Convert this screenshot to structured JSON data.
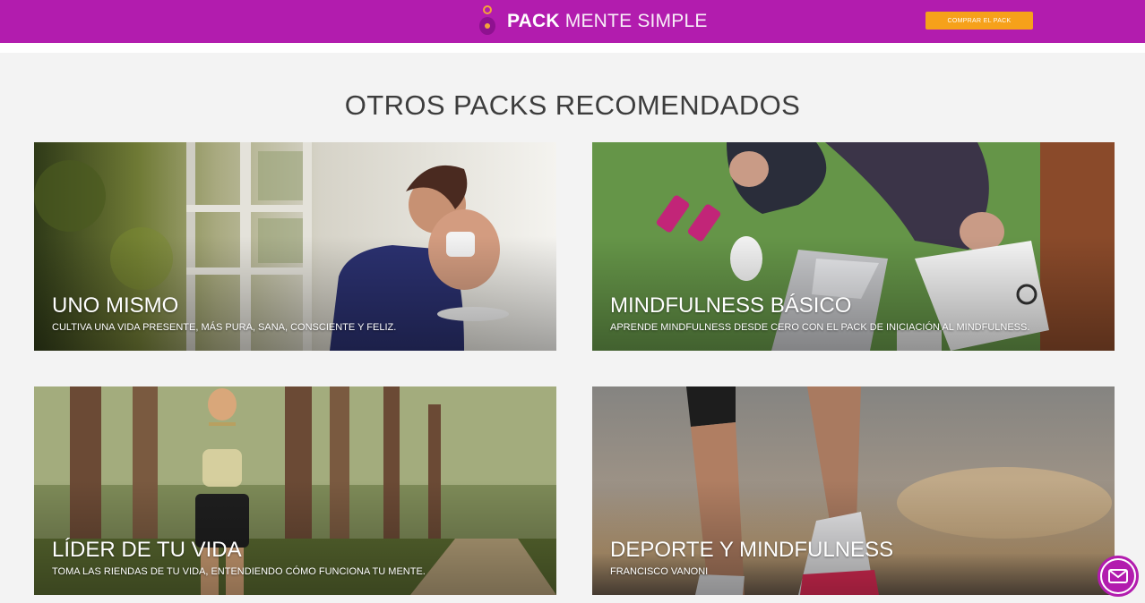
{
  "header": {
    "logo_bold": "PACK",
    "logo_light": " MENTE SIMPLE",
    "buy_button": "COMPRAR EL PACK"
  },
  "section": {
    "title": "OTROS PACKS RECOMENDADOS"
  },
  "cards": [
    {
      "title": "UNO MISMO",
      "subtitle": "CULTIVA UNA VIDA PRESENTE, MÁS PURA, SANA, CONSCIENTE Y FELIZ."
    },
    {
      "title": "MINDFULNESS BÁSICO",
      "subtitle": "APRENDE MINDFULNESS DESDE CERO CON EL PACK DE INICIACIÓN AL MINDFULNESS."
    },
    {
      "title": "LÍDER DE TU VIDA",
      "subtitle": "TOMA LAS RIENDAS DE TU VIDA, ENTENDIENDO CÓMO FUNCIONA TU MENTE."
    },
    {
      "title": "DEPORTE Y MINDFULNESS",
      "subtitle": "FRANCISCO VANONI"
    }
  ],
  "colors": {
    "brand": "#b21cae",
    "accent": "#f6a11a"
  },
  "icons": {
    "logo": "lightbulb-logo-icon",
    "mail": "mail-icon"
  }
}
